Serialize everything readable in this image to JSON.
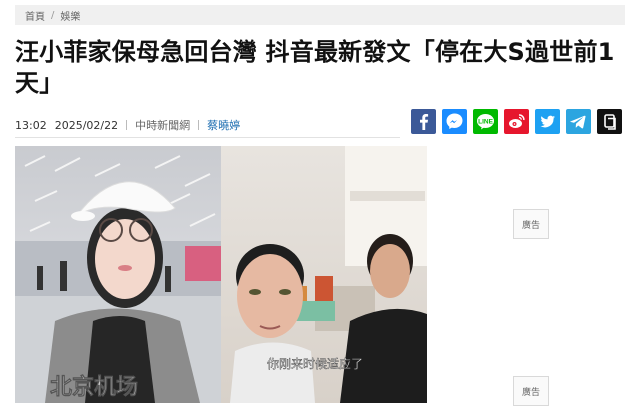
{
  "breadcrumb": {
    "home": "首頁",
    "separator": "/",
    "section": "娛樂"
  },
  "article": {
    "title": "汪小菲家保母急回台灣 抖音最新發文「停在大S過世前1天」",
    "time": "13:02",
    "date": "2025/02/22",
    "source": "中時新聞網",
    "author": "蔡曉婷"
  },
  "share_buttons": [
    {
      "name": "facebook-icon",
      "color": "#3b5998"
    },
    {
      "name": "messenger-icon",
      "color": "#1a8cff"
    },
    {
      "name": "line-icon",
      "color": "#00b900",
      "label": "LINE"
    },
    {
      "name": "weibo-icon",
      "color": "#e6162d"
    },
    {
      "name": "twitter-icon",
      "color": "#1da1f2"
    },
    {
      "name": "telegram-icon",
      "color": "#2ca5e0"
    },
    {
      "name": "copy-link-icon",
      "color": "#111111"
    }
  ],
  "hero_image": {
    "left_caption": "北京机场",
    "right_subtitle": "你刚来时候适应了"
  },
  "ads": {
    "label": "廣告"
  }
}
